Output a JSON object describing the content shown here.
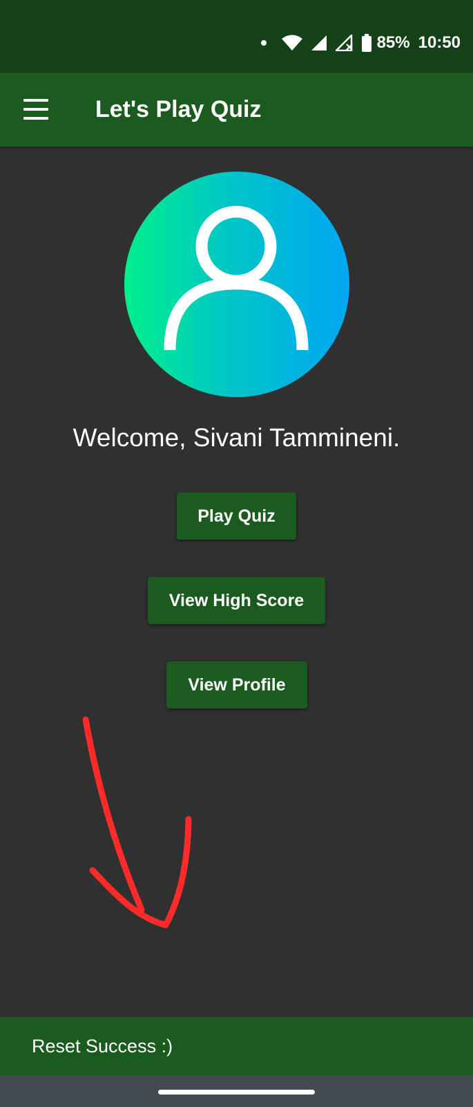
{
  "status_bar": {
    "battery_percent": "85%",
    "time": "10:50",
    "icons": [
      "notification-dot-icon",
      "wifi-icon",
      "signal-icon",
      "signal-no-service-icon",
      "battery-icon"
    ]
  },
  "app_bar": {
    "title": "Let's Play Quiz",
    "menu_icon": "hamburger-menu-icon"
  },
  "profile": {
    "avatar_icon": "user-avatar-icon",
    "welcome_text": "Welcome, Sivani Tammineni."
  },
  "buttons": {
    "play_quiz": "Play Quiz",
    "view_high_score": "View High Score",
    "view_profile": "View Profile"
  },
  "annotation": {
    "icon": "hand-drawn-arrow-icon",
    "color": "#ff2a2a"
  },
  "snackbar": {
    "message": "Reset Success :)"
  },
  "colors": {
    "status_bar": "#154116",
    "app_bar": "#1c5b1f",
    "background": "#303030",
    "avatar_gradient": [
      "#00ef8c",
      "#00c7c4",
      "#00a6f3"
    ]
  }
}
